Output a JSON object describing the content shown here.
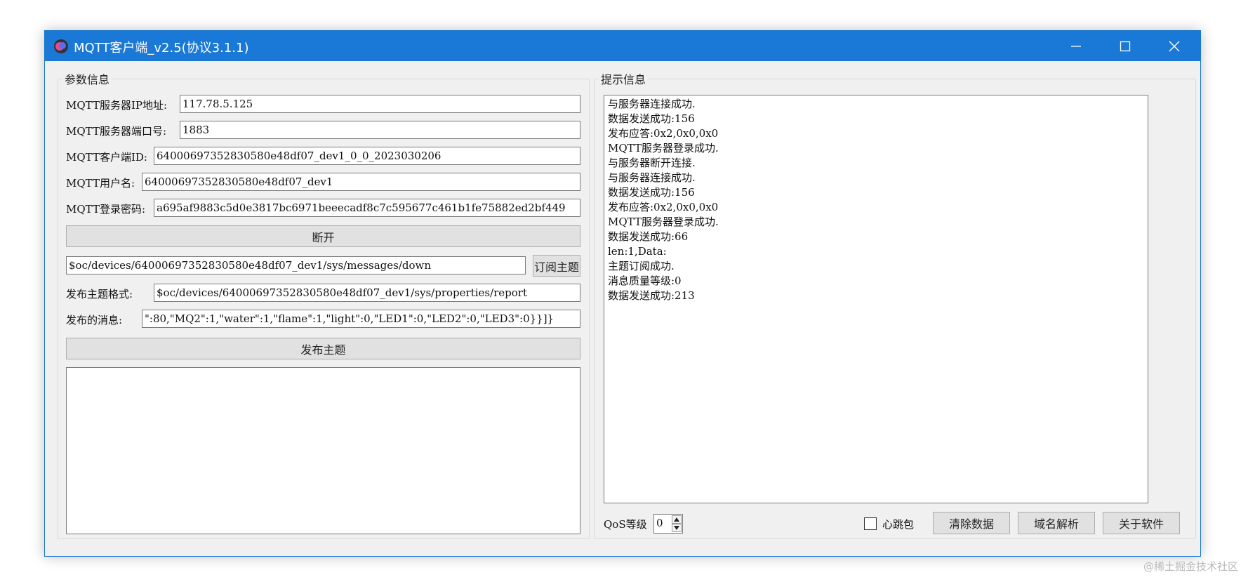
{
  "window": {
    "title": "MQTT客户端_v2.5(协议3.1.1)"
  },
  "params": {
    "group_label": "参数信息",
    "server_ip_label": "MQTT服务器IP地址:",
    "server_ip_value": "117.78.5.125",
    "server_port_label": "MQTT服务器端口号:",
    "server_port_value": "1883",
    "client_id_label": "MQTT客户端ID:",
    "client_id_value": "64000697352830580e48df07_dev1_0_0_2023030206",
    "username_label": "MQTT用户名:",
    "username_value": "64000697352830580e48df07_dev1",
    "password_label": "MQTT登录密码:",
    "password_value": "a695af9883c5d0e3817bc6971beeecadf8c7c595677c461b1fe75882ed2bf449",
    "connect_button": "断开",
    "subscribe_topic_value": "$oc/devices/64000697352830580e48df07_dev1/sys/messages/down",
    "subscribe_button": "订阅主题",
    "publish_topic_label": "发布主题格式:",
    "publish_topic_value": "$oc/devices/64000697352830580e48df07_dev1/sys/properties/report",
    "publish_message_label": "发布的消息:",
    "publish_message_value": "\":80,\"MQ2\":1,\"water\":1,\"flame\":1,\"light\":0,\"LED1\":0,\"LED2\":0,\"LED3\":0}}]}",
    "publish_button": "发布主题"
  },
  "info": {
    "group_label": "提示信息",
    "log": [
      "与服务器连接成功.",
      "数据发送成功:156",
      "发布应答:0x2,0x0,0x0",
      "MQTT服务器登录成功.",
      "与服务器断开连接.",
      "与服务器连接成功.",
      "数据发送成功:156",
      "发布应答:0x2,0x0,0x0",
      "MQTT服务器登录成功.",
      "数据发送成功:66",
      "len:1,Data:",
      "主题订阅成功.",
      "消息质量等级:0",
      "数据发送成功:213"
    ],
    "qos_label": "QoS等级",
    "qos_value": "0",
    "heartbeat_label": "心跳包",
    "heartbeat_checked": false,
    "clear_button": "清除数据",
    "dns_button": "域名解析",
    "about_button": "关于软件"
  },
  "watermark": "@稀土掘金技术社区"
}
